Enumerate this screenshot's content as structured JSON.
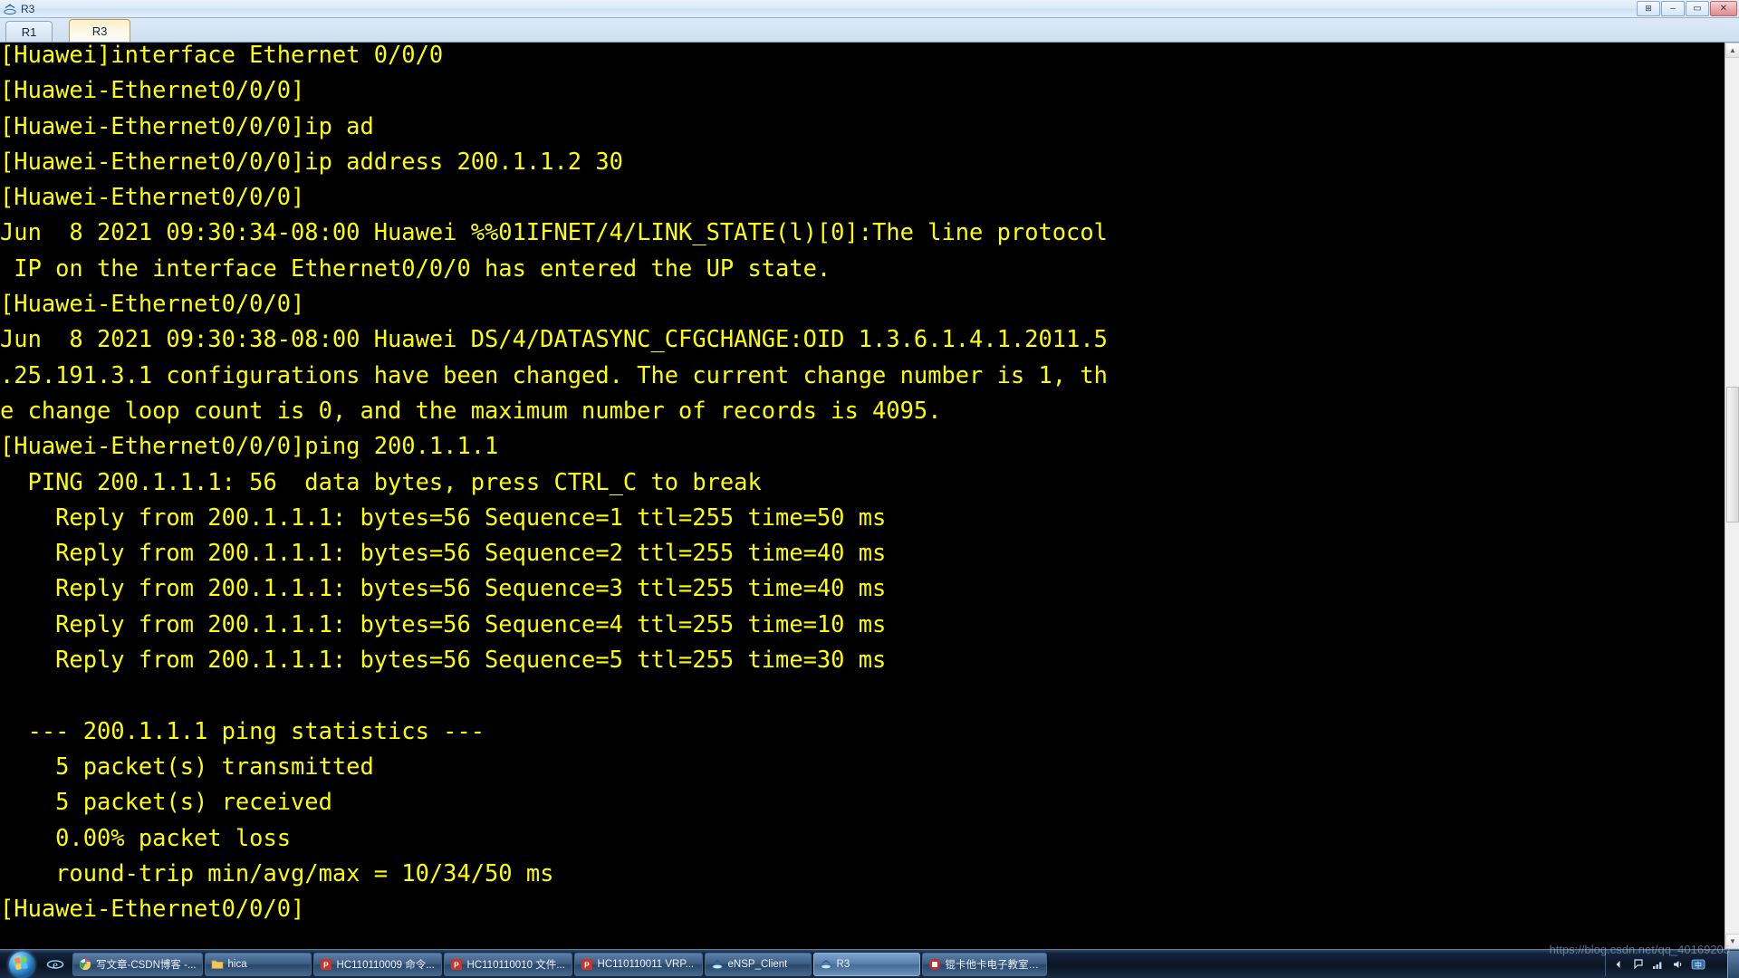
{
  "window": {
    "title": "R3",
    "icon": "router-icon",
    "buttons": {
      "restore_left": "⊞",
      "minimize": "–",
      "maximize": "▭",
      "close": "✕"
    }
  },
  "tabs": [
    {
      "label": "R1",
      "active": false
    },
    {
      "label": "R3",
      "active": true
    }
  ],
  "terminal": {
    "fg_color": "#ffff00",
    "bg_color": "#000000",
    "lines": [
      "[Huawei]interface Ethernet 0/0/0",
      "[Huawei-Ethernet0/0/0]",
      "[Huawei-Ethernet0/0/0]ip ad",
      "[Huawei-Ethernet0/0/0]ip address 200.1.1.2 30",
      "[Huawei-Ethernet0/0/0]",
      "Jun  8 2021 09:30:34-08:00 Huawei %%01IFNET/4/LINK_STATE(l)[0]:The line protocol",
      " IP on the interface Ethernet0/0/0 has entered the UP state.",
      "[Huawei-Ethernet0/0/0]",
      "Jun  8 2021 09:30:38-08:00 Huawei DS/4/DATASYNC_CFGCHANGE:OID 1.3.6.1.4.1.2011.5",
      ".25.191.3.1 configurations have been changed. The current change number is 1, th",
      "e change loop count is 0, and the maximum number of records is 4095.",
      "[Huawei-Ethernet0/0/0]ping 200.1.1.1",
      "  PING 200.1.1.1: 56  data bytes, press CTRL_C to break",
      "    Reply from 200.1.1.1: bytes=56 Sequence=1 ttl=255 time=50 ms",
      "    Reply from 200.1.1.1: bytes=56 Sequence=2 ttl=255 time=40 ms",
      "    Reply from 200.1.1.1: bytes=56 Sequence=3 ttl=255 time=40 ms",
      "    Reply from 200.1.1.1: bytes=56 Sequence=4 ttl=255 time=10 ms",
      "    Reply from 200.1.1.1: bytes=56 Sequence=5 ttl=255 time=30 ms",
      "",
      "  --- 200.1.1.1 ping statistics ---",
      "    5 packet(s) transmitted",
      "    5 packet(s) received",
      "    0.00% packet loss",
      "    round-trip min/avg/max = 10/34/50 ms",
      "[Huawei-Ethernet0/0/0]"
    ]
  },
  "scrollbar": {
    "up_arrow": "▲",
    "down_arrow": "▼"
  },
  "taskbar": {
    "start_label": "Start",
    "quicklaunch": [
      {
        "name": "internet-explorer-icon",
        "glyph": "e"
      }
    ],
    "tasks": [
      {
        "label": "写文章-CSDN博客 -...",
        "icon": "chrome-icon",
        "active": false
      },
      {
        "label": "hica",
        "icon": "folder-icon",
        "active": false
      },
      {
        "label": "HC110110009 命令...",
        "icon": "powerpoint-icon",
        "active": false
      },
      {
        "label": "HC110110010 文件...",
        "icon": "powerpoint-icon",
        "active": false
      },
      {
        "label": "HC110110011 VRP...",
        "icon": "powerpoint-icon",
        "active": false
      },
      {
        "label": "eNSP_Client",
        "icon": "ensp-icon",
        "active": false
      },
      {
        "label": "R3",
        "icon": "router-icon",
        "active": true
      },
      {
        "label": "锟卡他卡电子教室教...",
        "icon": "red-app-icon",
        "active": false
      }
    ],
    "tray": [
      {
        "name": "show-hidden-icons-arrow",
        "glyph": "◄"
      },
      {
        "name": "action-center-icon",
        "glyph": "⚑"
      },
      {
        "name": "network-icon",
        "glyph": "▂▄▆"
      },
      {
        "name": "volume-icon",
        "glyph": "🔊"
      },
      {
        "name": "ime-icon",
        "glyph": "中"
      },
      {
        "name": "battery-icon",
        "glyph": "▮"
      }
    ]
  },
  "watermark": "https://blog.csdn.net/qq_40169205"
}
